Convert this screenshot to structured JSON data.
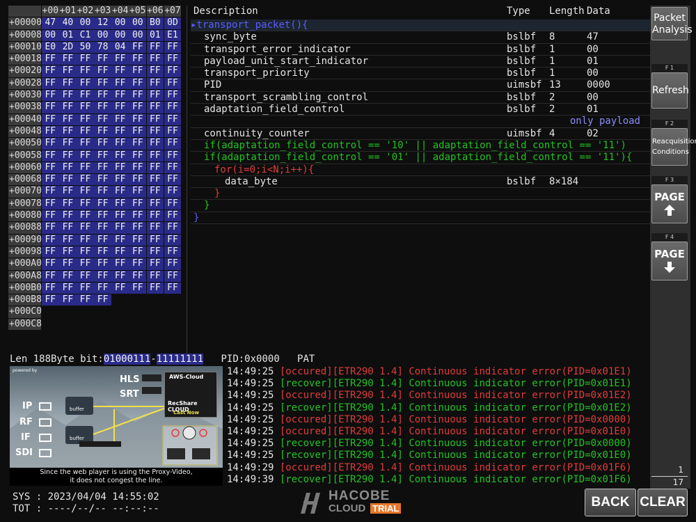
{
  "hex_dump": {
    "columns": [
      "+00",
      "+01",
      "+02",
      "+03",
      "+04",
      "+05",
      "+06",
      "+07"
    ],
    "rows": [
      {
        "addr": "+00000",
        "bytes": [
          "47",
          "40",
          "00",
          "12",
          "00",
          "00",
          "B0",
          "0D"
        ]
      },
      {
        "addr": "+00008",
        "bytes": [
          "00",
          "01",
          "C1",
          "00",
          "00",
          "00",
          "01",
          "E1"
        ]
      },
      {
        "addr": "+00010",
        "bytes": [
          "E0",
          "2D",
          "50",
          "78",
          "04",
          "FF",
          "FF",
          "FF"
        ]
      },
      {
        "addr": "+00018",
        "bytes": [
          "FF",
          "FF",
          "FF",
          "FF",
          "FF",
          "FF",
          "FF",
          "FF"
        ]
      },
      {
        "addr": "+00020",
        "bytes": [
          "FF",
          "FF",
          "FF",
          "FF",
          "FF",
          "FF",
          "FF",
          "FF"
        ]
      },
      {
        "addr": "+00028",
        "bytes": [
          "FF",
          "FF",
          "FF",
          "FF",
          "FF",
          "FF",
          "FF",
          "FF"
        ]
      },
      {
        "addr": "+00030",
        "bytes": [
          "FF",
          "FF",
          "FF",
          "FF",
          "FF",
          "FF",
          "FF",
          "FF"
        ]
      },
      {
        "addr": "+00038",
        "bytes": [
          "FF",
          "FF",
          "FF",
          "FF",
          "FF",
          "FF",
          "FF",
          "FF"
        ]
      },
      {
        "addr": "+00040",
        "bytes": [
          "FF",
          "FF",
          "FF",
          "FF",
          "FF",
          "FF",
          "FF",
          "FF"
        ]
      },
      {
        "addr": "+00048",
        "bytes": [
          "FF",
          "FF",
          "FF",
          "FF",
          "FF",
          "FF",
          "FF",
          "FF"
        ]
      },
      {
        "addr": "+00050",
        "bytes": [
          "FF",
          "FF",
          "FF",
          "FF",
          "FF",
          "FF",
          "FF",
          "FF"
        ]
      },
      {
        "addr": "+00058",
        "bytes": [
          "FF",
          "FF",
          "FF",
          "FF",
          "FF",
          "FF",
          "FF",
          "FF"
        ]
      },
      {
        "addr": "+00060",
        "bytes": [
          "FF",
          "FF",
          "FF",
          "FF",
          "FF",
          "FF",
          "FF",
          "FF"
        ]
      },
      {
        "addr": "+00068",
        "bytes": [
          "FF",
          "FF",
          "FF",
          "FF",
          "FF",
          "FF",
          "FF",
          "FF"
        ]
      },
      {
        "addr": "+00070",
        "bytes": [
          "FF",
          "FF",
          "FF",
          "FF",
          "FF",
          "FF",
          "FF",
          "FF"
        ]
      },
      {
        "addr": "+00078",
        "bytes": [
          "FF",
          "FF",
          "FF",
          "FF",
          "FF",
          "FF",
          "FF",
          "FF"
        ]
      },
      {
        "addr": "+00080",
        "bytes": [
          "FF",
          "FF",
          "FF",
          "FF",
          "FF",
          "FF",
          "FF",
          "FF"
        ]
      },
      {
        "addr": "+00088",
        "bytes": [
          "FF",
          "FF",
          "FF",
          "FF",
          "FF",
          "FF",
          "FF",
          "FF"
        ]
      },
      {
        "addr": "+00090",
        "bytes": [
          "FF",
          "FF",
          "FF",
          "FF",
          "FF",
          "FF",
          "FF",
          "FF"
        ]
      },
      {
        "addr": "+00098",
        "bytes": [
          "FF",
          "FF",
          "FF",
          "FF",
          "FF",
          "FF",
          "FF",
          "FF"
        ]
      },
      {
        "addr": "+000A0",
        "bytes": [
          "FF",
          "FF",
          "FF",
          "FF",
          "FF",
          "FF",
          "FF",
          "FF"
        ]
      },
      {
        "addr": "+000A8",
        "bytes": [
          "FF",
          "FF",
          "FF",
          "FF",
          "FF",
          "FF",
          "FF",
          "FF"
        ]
      },
      {
        "addr": "+000B0",
        "bytes": [
          "FF",
          "FF",
          "FF",
          "FF",
          "FF",
          "FF",
          "FF",
          "FF"
        ]
      },
      {
        "addr": "+000B8",
        "bytes": [
          "FF",
          "FF",
          "FF",
          "FF"
        ]
      },
      {
        "addr": "+000C0",
        "bytes": []
      },
      {
        "addr": "+000C8",
        "bytes": []
      }
    ]
  },
  "syntax_table": {
    "headers": {
      "description": "Description",
      "type": "Type",
      "length": "Length",
      "data": "Data"
    },
    "rows": [
      {
        "desc": "transport_packet(){",
        "indent": 0,
        "color": "blue",
        "type": "",
        "length": "",
        "data": "",
        "note": "",
        "marker": "▸",
        "highlight": true
      },
      {
        "desc": "sync_byte",
        "indent": 1,
        "color": "white",
        "type": "bslbf",
        "length": "8",
        "data": "47",
        "note": ""
      },
      {
        "desc": "transport_error_indicator",
        "indent": 1,
        "color": "white",
        "type": "bslbf",
        "length": "1",
        "data": "00",
        "note": ""
      },
      {
        "desc": "payload_unit_start_indicator",
        "indent": 1,
        "color": "white",
        "type": "bslbf",
        "length": "1",
        "data": "01",
        "note": ""
      },
      {
        "desc": "transport_priority",
        "indent": 1,
        "color": "white",
        "type": "bslbf",
        "length": "1",
        "data": "00",
        "note": ""
      },
      {
        "desc": "PID",
        "indent": 1,
        "color": "white",
        "type": "uimsbf",
        "length": "13",
        "data": "0000",
        "note": ""
      },
      {
        "desc": "transport_scrambling_control",
        "indent": 1,
        "color": "white",
        "type": "bslbf",
        "length": "2",
        "data": "00",
        "note": ""
      },
      {
        "desc": "adaptation_field_control",
        "indent": 1,
        "color": "white",
        "type": "bslbf",
        "length": "2",
        "data": "01",
        "note": ""
      },
      {
        "desc": "",
        "indent": 1,
        "color": "white",
        "type": "",
        "length": "",
        "data": "",
        "note": "only payload"
      },
      {
        "desc": "continuity_counter",
        "indent": 1,
        "color": "white",
        "type": "uimsbf",
        "length": "4",
        "data": "02",
        "note": ""
      },
      {
        "desc": "if(adaptation_field_control == '10' || adaptation_field_control == '11')",
        "indent": 1,
        "color": "green",
        "type": "",
        "length": "",
        "data": "",
        "note": ""
      },
      {
        "desc": "if(adaptation_field_control == '01' || adaptation_field_control == '11'){",
        "indent": 1,
        "color": "green",
        "type": "",
        "length": "",
        "data": "",
        "note": ""
      },
      {
        "desc": "for(i=0;i<N;i++){",
        "indent": 2,
        "color": "red",
        "type": "",
        "length": "",
        "data": "",
        "note": ""
      },
      {
        "desc": "data_byte",
        "indent": 3,
        "color": "white",
        "type": "bslbf",
        "length": "8×184",
        "data": "",
        "note": ""
      },
      {
        "desc": "}",
        "indent": 2,
        "color": "red",
        "type": "",
        "length": "",
        "data": "",
        "note": ""
      },
      {
        "desc": "}",
        "indent": 1,
        "color": "green",
        "type": "",
        "length": "",
        "data": "",
        "note": ""
      },
      {
        "desc": "}",
        "indent": 0,
        "color": "blue",
        "type": "",
        "length": "",
        "data": "",
        "note": ""
      }
    ]
  },
  "status_line": {
    "len_text": "Len 188Byte bit:",
    "bit_first": "01000111",
    "bit_sep": "-",
    "bit_last": "11111111",
    "pid_text": "   PID:0x0000   PAT"
  },
  "video": {
    "powered_by": "powered by",
    "labels": {
      "hls": "HLS",
      "srt": "SRT",
      "ip": "IP",
      "rf": "RF",
      "if": "IF",
      "sdi": "SDI"
    },
    "cloud_title": "AWS-Cloud",
    "cloud_brand": "RecShare CLOUD",
    "castnow": "Cast Now",
    "buffer": "buffer",
    "caption_line1": "Since the web player is using the Proxy-Video,",
    "caption_line2": "it does not congest the line."
  },
  "log": [
    {
      "time": "14:49:25",
      "event": "[occured]",
      "code": "[ETR290 1.4]",
      "message": "Continuous indicator error(PID=0x01E1)"
    },
    {
      "time": "14:49:25",
      "event": "[recover]",
      "code": "[ETR290 1.4]",
      "message": "Continuous indicator error(PID=0x01E1)"
    },
    {
      "time": "14:49:25",
      "event": "[occured]",
      "code": "[ETR290 1.4]",
      "message": "Continuous indicator error(PID=0x01E2)"
    },
    {
      "time": "14:49:25",
      "event": "[recover]",
      "code": "[ETR290 1.4]",
      "message": "Continuous indicator error(PID=0x01E2)"
    },
    {
      "time": "14:49:25",
      "event": "[occured]",
      "code": "[ETR290 1.4]",
      "message": "Continuous indicator error(PID=0x0000)"
    },
    {
      "time": "14:49:25",
      "event": "[occured]",
      "code": "[ETR290 1.4]",
      "message": "Continuous indicator error(PID=0x01E0)"
    },
    {
      "time": "14:49:25",
      "event": "[recover]",
      "code": "[ETR290 1.4]",
      "message": "Continuous indicator error(PID=0x0000)"
    },
    {
      "time": "14:49:25",
      "event": "[recover]",
      "code": "[ETR290 1.4]",
      "message": "Continuous indicator error(PID=0x01E0)"
    },
    {
      "time": "14:49:29",
      "event": "[occured]",
      "code": "[ETR290 1.4]",
      "message": "Continuous indicator error(PID=0x01F6)"
    },
    {
      "time": "14:49:39",
      "event": "[recover]",
      "code": "[ETR290 1.4]",
      "message": "Continuous indicator error(PID=0x01F6)"
    }
  ],
  "sidebar": {
    "packet_analysis": {
      "line1": "Packet",
      "line2": "Analysis"
    },
    "refresh": {
      "fkey": "F 1",
      "label": "Refresh"
    },
    "reacquisition": {
      "fkey": "F 2",
      "line1": "Reacquisition",
      "line2": "Conditions"
    },
    "page_up": {
      "fkey": "F 3",
      "label": "PAGE",
      "icon": "arrow-up-icon"
    },
    "page_down": {
      "fkey": "F 4",
      "label": "PAGE",
      "icon": "arrow-down-icon"
    },
    "page_current": "1",
    "page_total": "17"
  },
  "footer": {
    "sys": "SYS : 2023/04/04 14:55:02",
    "tot": "TOT : ----/--/-- --:--:--",
    "logo_main": "HACOBE",
    "logo_cloud": "CLOUD",
    "logo_trial": "TRIAL",
    "back": "BACK",
    "clear": "CLEAR"
  },
  "colors": {
    "hex_cell_bg": "#2a2b88",
    "header_bg": "#3b3b3b",
    "occured": "#e23b3b",
    "recover": "#22c322",
    "trial_orange": "#e8782a"
  }
}
